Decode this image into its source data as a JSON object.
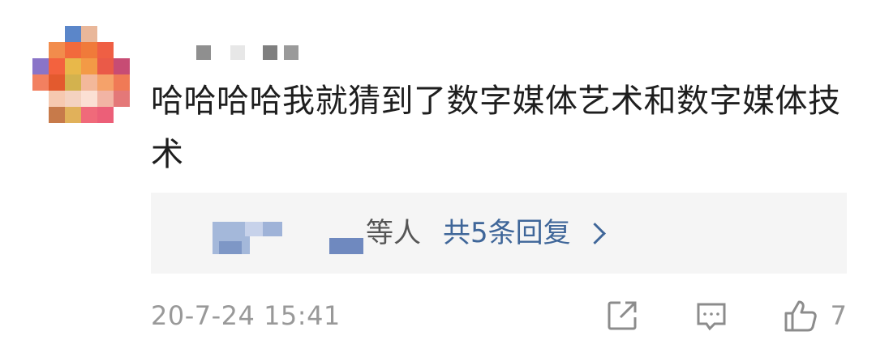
{
  "comment": {
    "text": "哈哈哈哈我就猜到了数字媒体艺术和数字媒体技术",
    "timestamp": "20-7-24 15:41"
  },
  "reply_preview": {
    "etc_label": "等人",
    "count_label": "共5条回复"
  },
  "actions": {
    "share_icon": "share-icon",
    "reply_icon": "comment-icon",
    "like_icon": "thumbs-up-icon",
    "like_count": "7"
  },
  "colors": {
    "link": "#3f6699",
    "muted": "#999999",
    "reply_bg": "#f5f5f5"
  }
}
